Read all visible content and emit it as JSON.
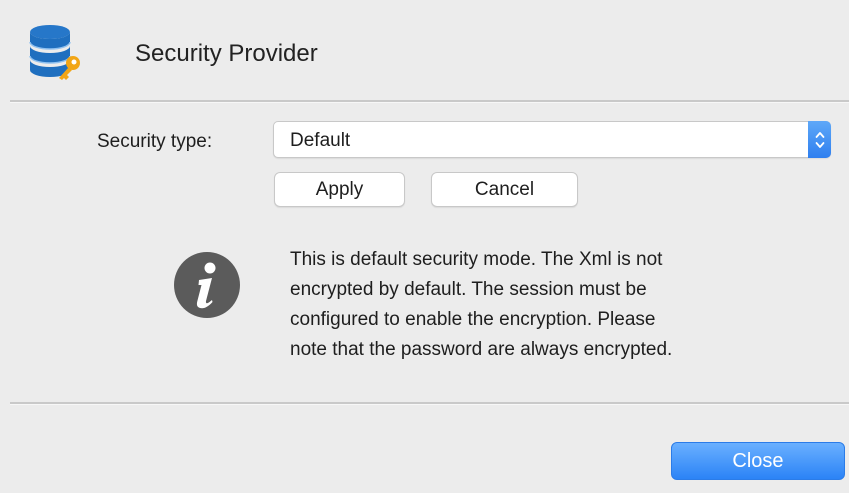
{
  "dialog": {
    "title": "Security Provider",
    "icon": "database-key-icon"
  },
  "security": {
    "label": "Security type:",
    "selected": "Default"
  },
  "buttons": {
    "apply": "Apply",
    "cancel": "Cancel",
    "close": "Close"
  },
  "info": {
    "icon": "info-icon",
    "lines": [
      "This is default security mode. The Xml is not",
      "encrypted by default. The session must be",
      "configured to enable the encryption. Please",
      "note that the password are always encrypted."
    ]
  },
  "colors": {
    "accent": "#2f7fef",
    "db_icon": "#1f6fbf",
    "key_icon": "#f2a515",
    "info_icon": "#555555"
  }
}
